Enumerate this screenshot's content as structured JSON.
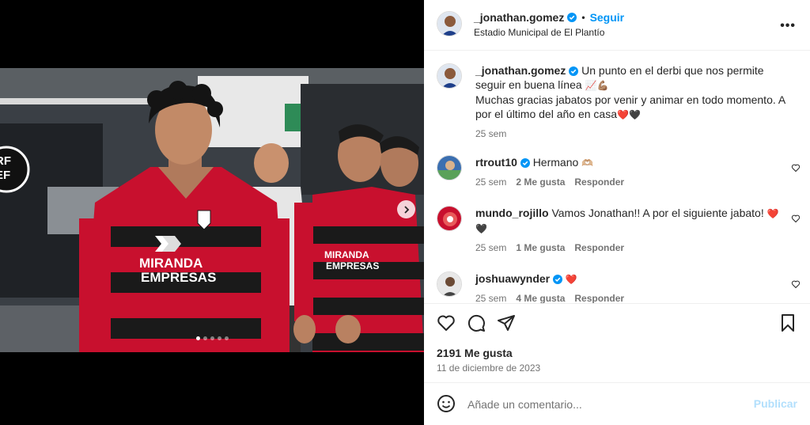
{
  "post": {
    "author": "_jonathan.gomez",
    "follow_label": "Seguir",
    "location": "Estadio Municipal de El Plantío",
    "more_icon": "more-horizontal-icon",
    "caption_line1": "Un punto en el derbi que nos permite seguir en buena línea",
    "caption_emoji1": "📈💪🏽",
    "caption_line2": "Muchas gracias jabatos por venir y animar en todo momento. A por el último del año en casa",
    "caption_emoji2": "❤️🖤",
    "caption_time": "25 sem",
    "likes": "2191 Me gusta",
    "date": "11 de diciembre de 2023",
    "media_slides": 5,
    "media_active_slide": 1
  },
  "photo": {
    "shirt_sponsor_line1": "MIRANDA",
    "shirt_sponsor_line2": "EMPRESAS",
    "badge_text": "RF EF"
  },
  "comments": [
    {
      "user": "rtrout10",
      "verified": true,
      "text": "Hermano",
      "emoji": "🫶🏼",
      "time": "25 sem",
      "likes": "2 Me gusta",
      "reply": "Responder"
    },
    {
      "user": "mundo_rojillo",
      "verified": false,
      "text": "Vamos Jonathan!! A por el siguiente jabato!",
      "emoji": "❤️🖤",
      "time": "25 sem",
      "likes": "1 Me gusta",
      "reply": "Responder"
    },
    {
      "user": "joshuawynder",
      "verified": true,
      "text": "",
      "emoji": "❤️",
      "time": "25 sem",
      "likes": "4 Me gusta",
      "reply": "Responder"
    }
  ],
  "composer": {
    "placeholder": "Añade un comentario...",
    "publish_label": "Publicar"
  },
  "colors": {
    "accent": "#0095f6",
    "muted": "#737373",
    "shirt_red": "#c8102e",
    "shirt_black": "#1a1a1a"
  }
}
